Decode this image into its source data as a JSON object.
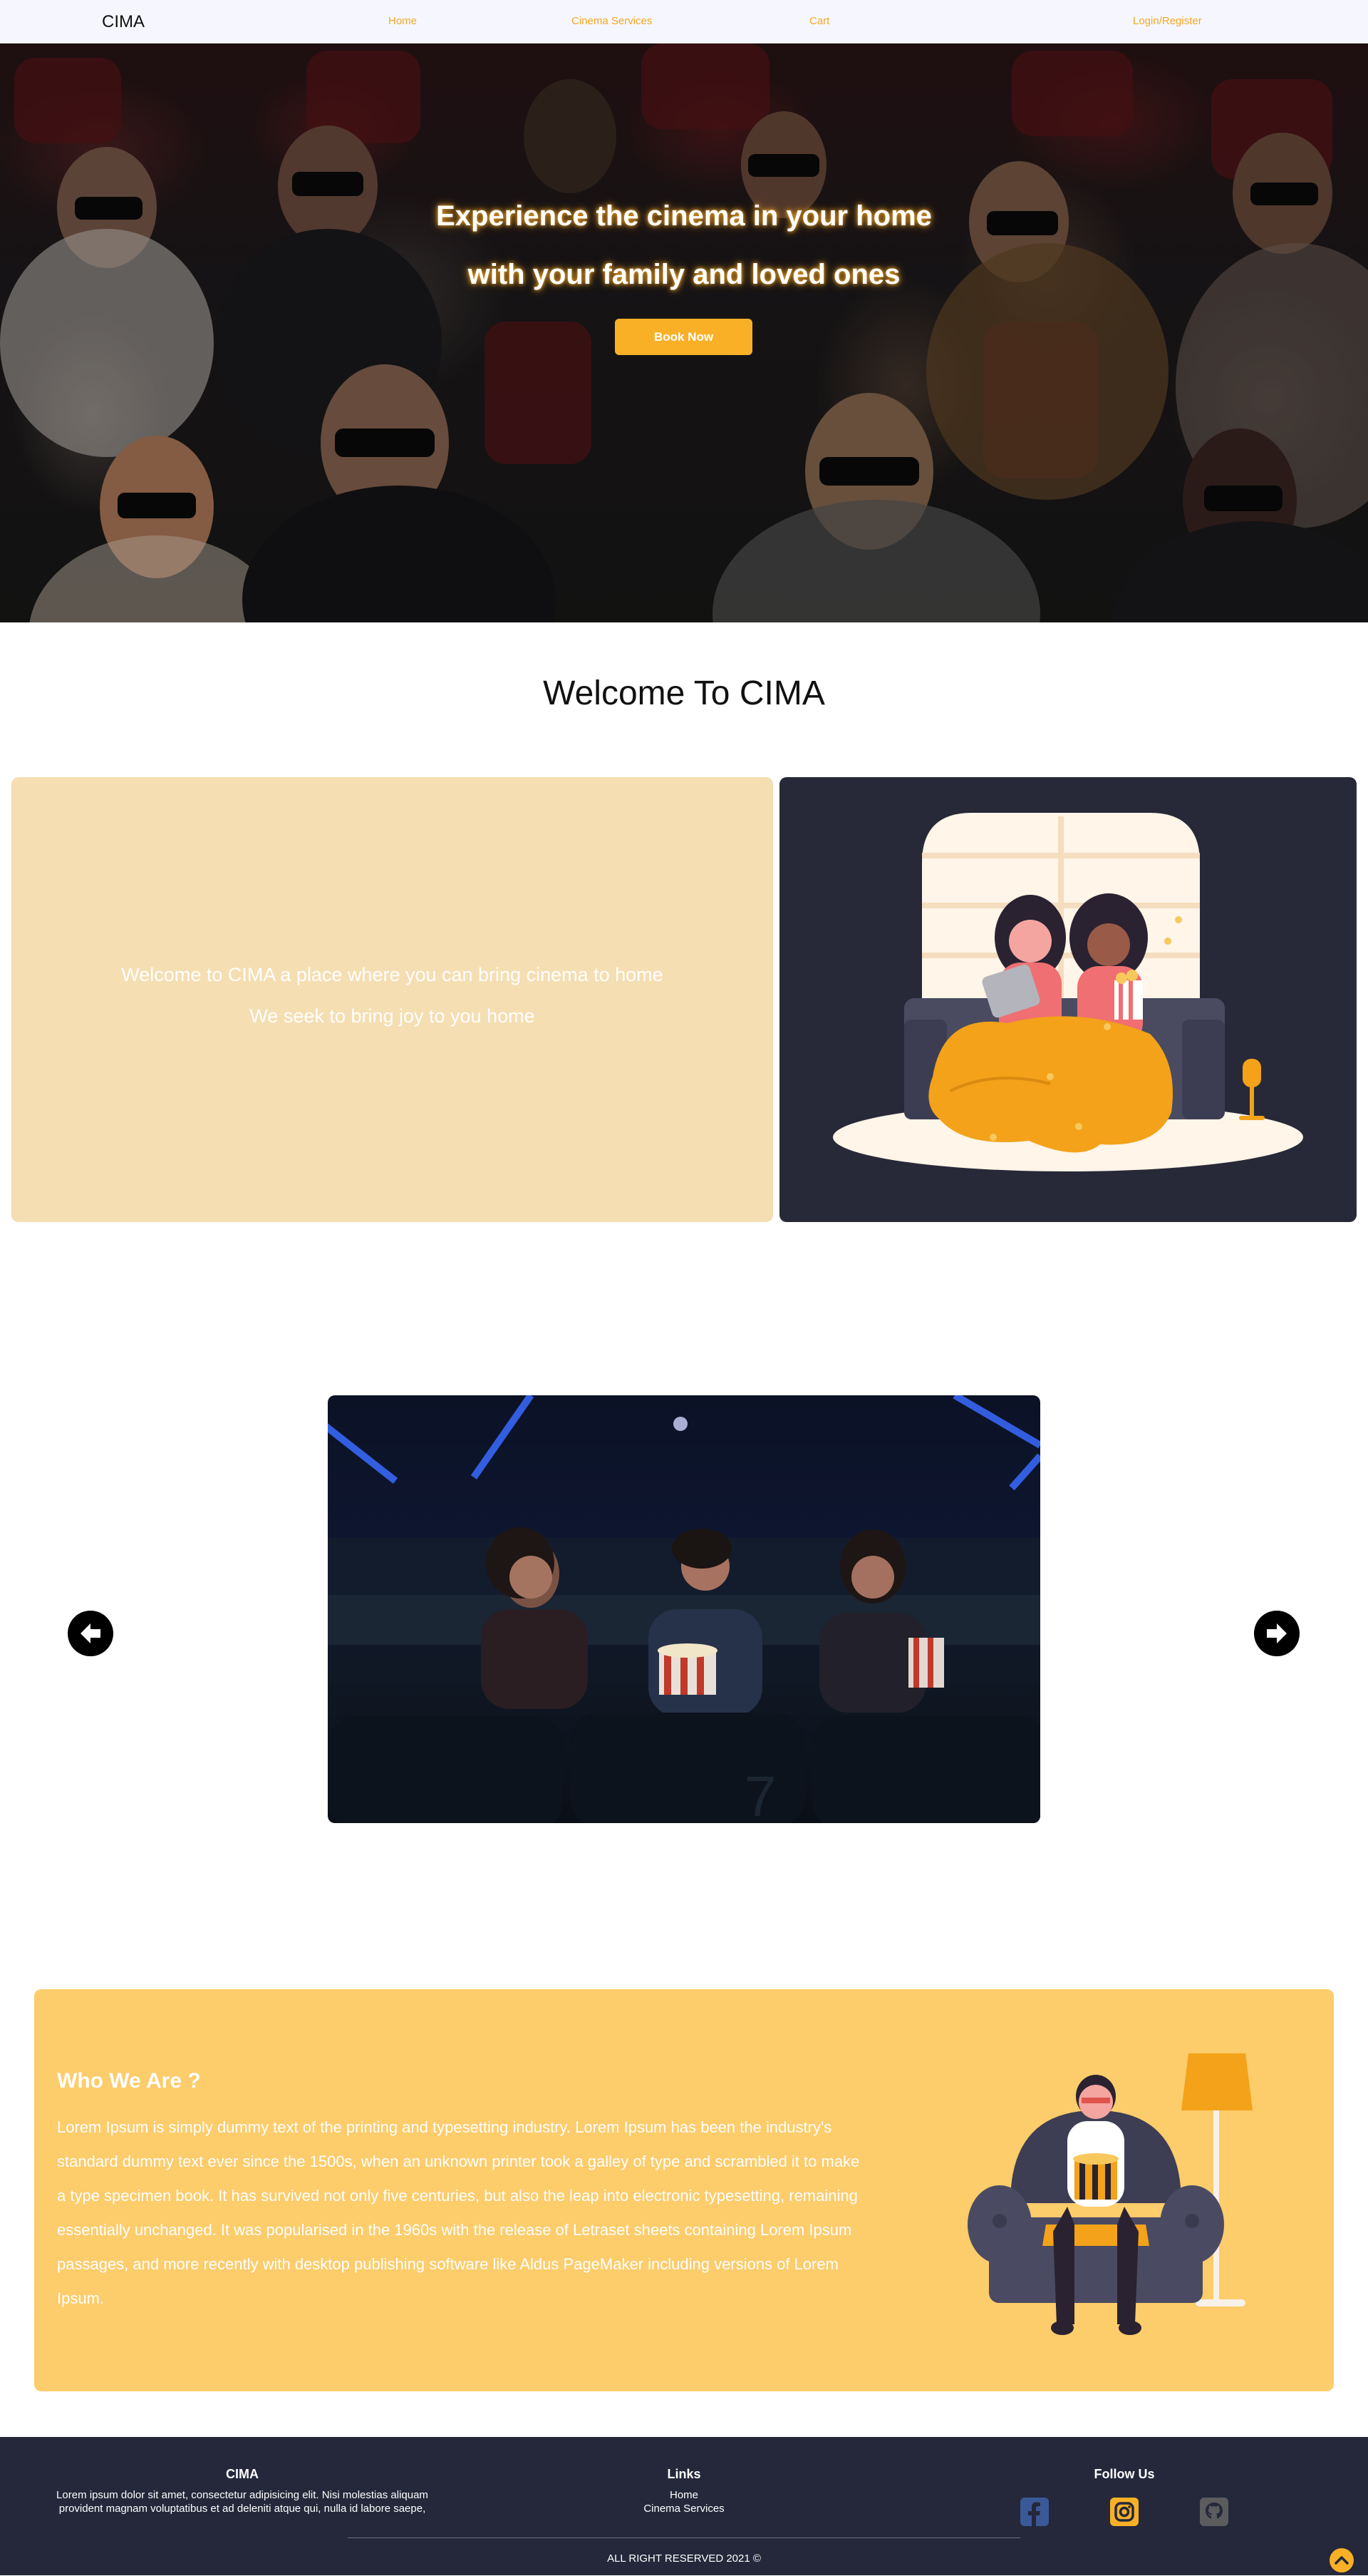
{
  "nav": {
    "brand": "CIMA",
    "links": [
      "Home",
      "Cinema Services",
      "Cart",
      "Login/Register"
    ]
  },
  "hero": {
    "line1": "Experience the cinema in your home",
    "line2": "with your family and loved ones",
    "cta": "Book Now"
  },
  "welcome": {
    "title": "Welcome To CIMA",
    "line1": "Welcome to CIMA a place where you can bring cinema to home",
    "line2": "We seek to bring joy to you home"
  },
  "carousel": {
    "prev_icon": "arrow-left-circle-icon",
    "next_icon": "arrow-right-circle-icon"
  },
  "about": {
    "title": "Who We Are ?",
    "body": "Lorem Ipsum is simply dummy text of the printing and typesetting industry. Lorem Ipsum has been the industry's standard dummy text ever since the 1500s, when an unknown printer took a galley of type and scrambled it to make a type specimen book. It has survived not only five centuries, but also the leap into electronic typesetting, remaining essentially unchanged. It was popularised in the 1960s with the release of Letraset sheets containing Lorem Ipsum passages, and more recently with desktop publishing software like Aldus PageMaker including versions of Lorem Ipsum."
  },
  "footer": {
    "brand_title": "CIMA",
    "brand_line1": "Lorem ipsum dolor sit amet, consectetur adipisicing elit. Nisi molestias aliquam",
    "brand_line2": "provident magnam voluptatibus et ad deleniti atque qui, nulla id labore saepe,",
    "links_title": "Links",
    "links": [
      "Home",
      "Cinema Services"
    ],
    "follow_title": "Follow Us",
    "social": [
      "facebook-icon",
      "instagram-icon",
      "github-icon"
    ],
    "copyright": "ALL RIGHT RESERVED 2021 ©"
  },
  "colors": {
    "accent": "#f9b027",
    "nav_link": "#f5a623",
    "welcome_panel": "#f5deb2",
    "dark_panel": "#272938",
    "about_panel": "#fdcc6b",
    "footer": "#24283a"
  }
}
